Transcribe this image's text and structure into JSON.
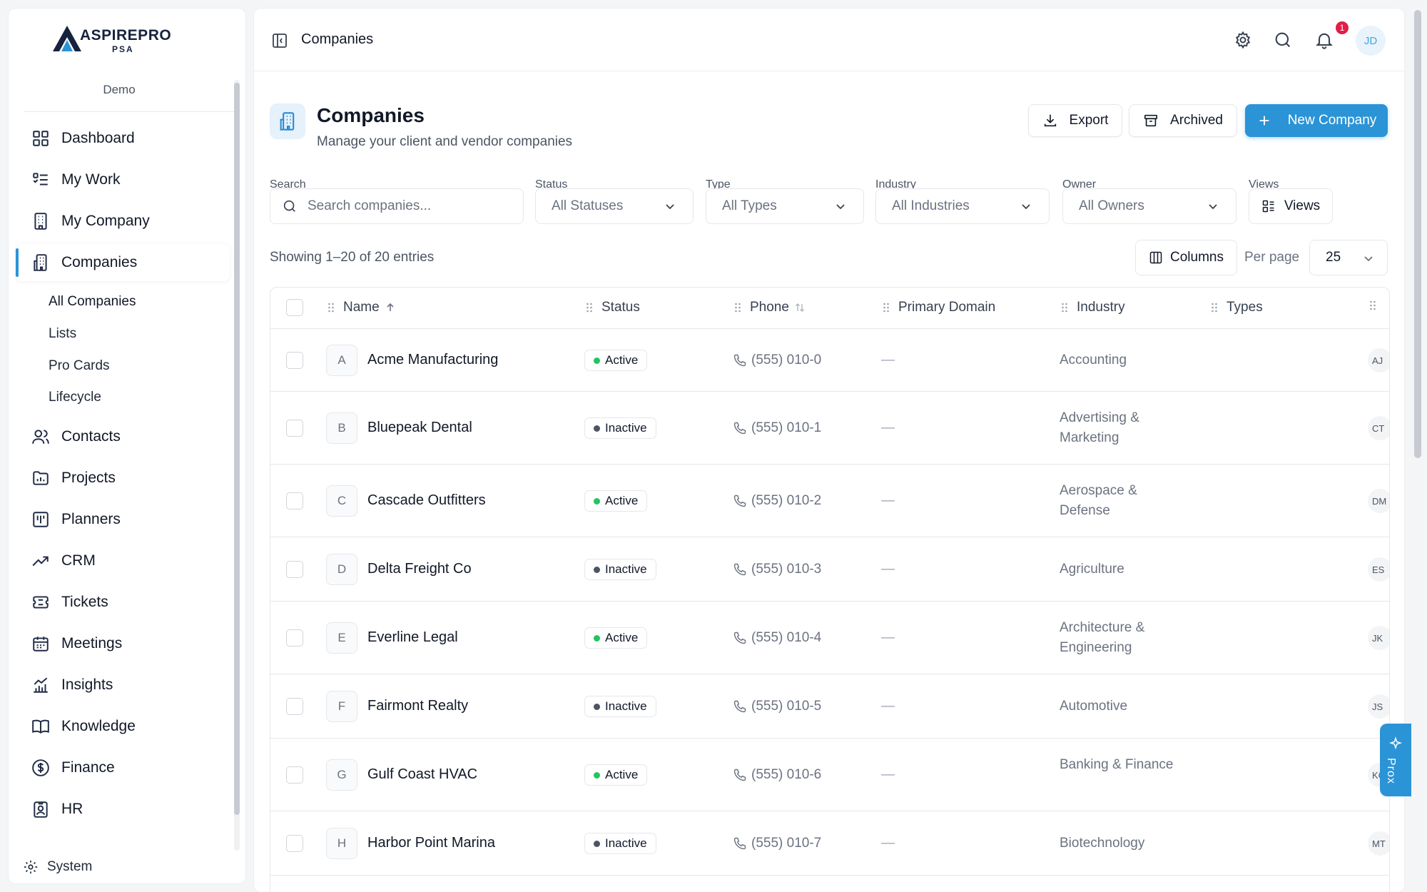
{
  "sidebar": {
    "logo_text": "ASPIREPRO",
    "logo_sub": "PSA",
    "environment": "Demo",
    "nav": [
      {
        "label": "Dashboard",
        "icon": "dashboard-icon"
      },
      {
        "label": "My Work",
        "icon": "my-work-icon"
      },
      {
        "label": "My Company",
        "icon": "building-icon"
      },
      {
        "label": "Companies",
        "icon": "companies-icon",
        "active": true
      },
      {
        "label": "Contacts",
        "icon": "contacts-icon"
      },
      {
        "label": "Projects",
        "icon": "projects-icon"
      },
      {
        "label": "Planners",
        "icon": "planners-icon"
      },
      {
        "label": "CRM",
        "icon": "trending-up-icon"
      },
      {
        "label": "Tickets",
        "icon": "ticket-icon"
      },
      {
        "label": "Meetings",
        "icon": "calendar-icon"
      },
      {
        "label": "Insights",
        "icon": "insights-icon"
      },
      {
        "label": "Knowledge",
        "icon": "book-icon"
      },
      {
        "label": "Finance",
        "icon": "dollar-icon"
      },
      {
        "label": "HR",
        "icon": "id-badge-icon"
      }
    ],
    "sub_nav": [
      "All Companies",
      "Lists",
      "Pro Cards",
      "Lifecycle"
    ],
    "system_label": "System"
  },
  "topbar": {
    "breadcrumb": "Companies",
    "notification_count": "1",
    "avatar_initials": "JD"
  },
  "header": {
    "title": "Companies",
    "subtitle": "Manage your client and vendor companies",
    "export_label": "Export",
    "archived_label": "Archived",
    "new_label": "New Company"
  },
  "filters": {
    "search_label": "Search",
    "search_placeholder": "Search companies...",
    "status_label": "Status",
    "status_value": "All Statuses",
    "type_label": "Type",
    "type_value": "All Types",
    "industry_label": "Industry",
    "industry_value": "All Industries",
    "owner_label": "Owner",
    "owner_value": "All Owners",
    "views_label": "Views",
    "views_button": "Views"
  },
  "list_meta": {
    "showing": "Showing 1–20 of 20 entries",
    "columns_label": "Columns",
    "per_page_label": "Per page",
    "per_page_value": "25"
  },
  "table": {
    "columns": [
      "Name",
      "Status",
      "Phone",
      "Primary Domain",
      "Industry",
      "Types"
    ],
    "rows": [
      {
        "letter": "A",
        "name": "Acme Manufacturing",
        "status": "Active",
        "phone": "(555) 010-0",
        "domain": "—",
        "industry": "Accounting",
        "owner": "AJ"
      },
      {
        "letter": "B",
        "name": "Bluepeak Dental",
        "status": "Inactive",
        "phone": "(555) 010-1",
        "domain": "—",
        "industry": "Advertising & Marketing",
        "owner": "CT"
      },
      {
        "letter": "C",
        "name": "Cascade Outfitters",
        "status": "Active",
        "phone": "(555) 010-2",
        "domain": "—",
        "industry": "Aerospace & Defense",
        "owner": "DM"
      },
      {
        "letter": "D",
        "name": "Delta Freight Co",
        "status": "Inactive",
        "phone": "(555) 010-3",
        "domain": "—",
        "industry": "Agriculture",
        "owner": "ES"
      },
      {
        "letter": "E",
        "name": "Everline Legal",
        "status": "Active",
        "phone": "(555) 010-4",
        "domain": "—",
        "industry": "Architecture & Engineering",
        "owner": "JK"
      },
      {
        "letter": "F",
        "name": "Fairmont Realty",
        "status": "Inactive",
        "phone": "(555) 010-5",
        "domain": "—",
        "industry": "Automotive",
        "owner": "JS"
      },
      {
        "letter": "G",
        "name": "Gulf Coast HVAC",
        "status": "Active",
        "phone": "(555) 010-6",
        "domain": "—",
        "industry": "Banking & Finance",
        "owner": "KC"
      },
      {
        "letter": "H",
        "name": "Harbor Point Marina",
        "status": "Inactive",
        "phone": "(555) 010-7",
        "domain": "—",
        "industry": "Biotechnology",
        "owner": "MT"
      }
    ]
  },
  "ai_tab": {
    "label": "Prox"
  },
  "colors": {
    "accent": "#2b94d6",
    "active_dot": "#22c55e",
    "inactive_dot": "#4b5563",
    "badge": "#e11d48"
  }
}
